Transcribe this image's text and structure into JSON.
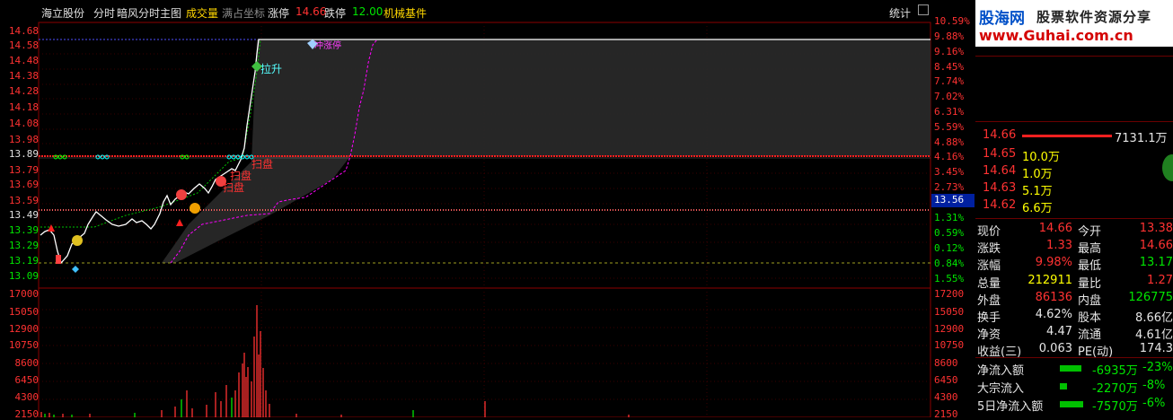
{
  "header": {
    "stock_name": "海立股份",
    "view_mode": "分时",
    "main_indicator": "暗风分时主图",
    "volume_label": "成交量",
    "coord_mode": "满占坐标",
    "limit_up_label": "涨停",
    "limit_up_value": "14.66",
    "limit_down_label": "跌停",
    "limit_down_value": "12.00",
    "sector": "机械基件",
    "stats_button": "统计"
  },
  "colors": {
    "up": "#ff3232",
    "down": "#00e600",
    "price_line": "#ffffff",
    "avg_line": "#ff00ff"
  },
  "price_axis": {
    "left": [
      "14.68",
      "14.58",
      "14.48",
      "14.38",
      "14.28",
      "14.18",
      "14.08",
      "13.98",
      "13.89",
      "13.79",
      "13.69",
      "13.59",
      "13.49",
      "13.39",
      "13.29",
      "13.19",
      "13.09"
    ],
    "right": [
      "10.59%",
      "9.88%",
      "9.16%",
      "8.45%",
      "7.74%",
      "7.02%",
      "6.31%",
      "5.59%",
      "4.88%",
      "4.16%",
      "3.45%",
      "2.73%",
      "",
      "1.31%",
      "0.59%",
      "0.12%",
      "0.84%",
      "1.55%"
    ],
    "current_price_tag": "13.56"
  },
  "volume_axis": {
    "left": [
      "17000",
      "15050",
      "12900",
      "10750",
      "8600",
      "6450",
      "4300",
      "2150"
    ],
    "right": [
      "17200",
      "15050",
      "12900",
      "10750",
      "8600",
      "6450",
      "4300",
      "2150"
    ]
  },
  "annotations": {
    "pull_up": "拉升",
    "limit_up_tag": "冲涨停",
    "sweep_1": "扫盘",
    "sweep_2": "扫盘",
    "sweep_3": "扫盘"
  },
  "quotes": {
    "top_price": "14.66",
    "top_volume": "7131.1万",
    "bids": [
      {
        "price": "14.65",
        "vol": "10.0万"
      },
      {
        "price": "14.64",
        "vol": "1.0万"
      },
      {
        "price": "14.63",
        "vol": "5.1万"
      },
      {
        "price": "14.62",
        "vol": "6.6万"
      }
    ]
  },
  "stats": [
    {
      "label": "现价",
      "value": "14.66",
      "label2": "今开",
      "value2": "13.38"
    },
    {
      "label": "涨跌",
      "value": "1.33",
      "label2": "最高",
      "value2": "14.66"
    },
    {
      "label": "涨幅",
      "value": "9.98%",
      "label2": "最低",
      "value2": "13.17"
    },
    {
      "label": "总量",
      "value": "212911",
      "label2": "量比",
      "value2": "1.27"
    },
    {
      "label": "外盘",
      "value": "86136",
      "label2": "内盘",
      "value2": "126775"
    },
    {
      "label": "换手",
      "value": "4.62%",
      "label2": "股本",
      "value2": "8.66亿"
    },
    {
      "label": "净资",
      "value": "4.47",
      "label2": "流通",
      "value2": "4.61亿"
    },
    {
      "label": "收益(三)",
      "value": "0.063",
      "label2": "PE(动)",
      "value2": "174.3"
    }
  ],
  "flows": [
    {
      "label": "净流入额",
      "value": "-6935万",
      "pct": "-23%",
      "bar": 0.55
    },
    {
      "label": "大宗流入",
      "value": "-2270万",
      "pct": "-8%",
      "bar": 0.18
    },
    {
      "label": "5日净流入额",
      "value": "-7570万",
      "pct": "-6%",
      "bar": 0.6
    }
  ],
  "logo": {
    "site_cn": "股海网",
    "slogan": "股票软件资源分享",
    "url": "www.Guhai.com.cn"
  }
}
